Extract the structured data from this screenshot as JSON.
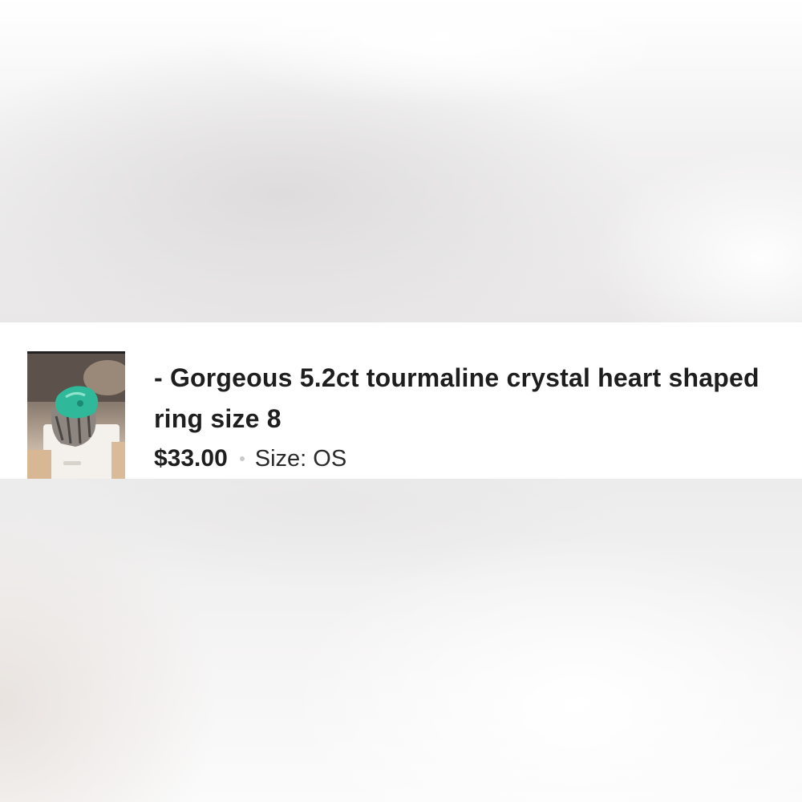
{
  "listing": {
    "title": "- Gorgeous 5.2ct tourmaline crystal heart shaped ring size 8",
    "price": "$33.00",
    "size": "Size: OS",
    "thumbnail_icon": "ring-photo",
    "separator_icon": "dot-separator-icon"
  },
  "colors": {
    "text": "#1e1e1e",
    "gem": "#2fb99a",
    "separator": "#c9c9c9"
  }
}
